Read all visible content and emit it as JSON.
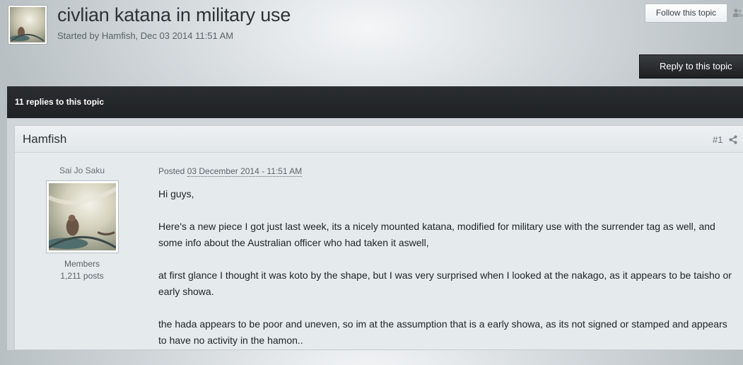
{
  "topic": {
    "title": "civlian katana in military use",
    "meta": "Started by Hamfish, Dec 03 2014 11:51 AM",
    "follow_label": "Follow this topic",
    "reply_label": "Reply to this topic",
    "replies_label": "11 replies to this topic"
  },
  "post": {
    "author": "Hamfish",
    "number": "#1",
    "member_title": "Sai Jo Saku",
    "group": "Members",
    "post_count": "1,211 posts",
    "posted_prefix": "Posted",
    "posted_date": "03 December 2014 - 11:51 AM",
    "paragraphs": [
      "Hi guys,",
      "Here's a new piece I got just last week, its a nicely mounted katana, modified for military use with the surrender tag as well, and some info about the Australian officer who had taken it aswell,",
      "at first glance I thought it was koto by the shape, but I was very surprised when I looked at the nakago, as it appears to be taisho or early showa.",
      "the hada appears to be poor and uneven, so im at the assumption that is a early showa, as its not signed or stamped and appears to have no activity in the hamon.."
    ]
  },
  "icons": {
    "followers": "followers-icon",
    "share": "share-icon",
    "topic_avatar": "user-avatar",
    "author_avatar": "user-avatar"
  },
  "colors": {
    "dark_bar": "#2b2e31",
    "reply_button": "#1d1f21",
    "post_background": "#e5eaed"
  }
}
